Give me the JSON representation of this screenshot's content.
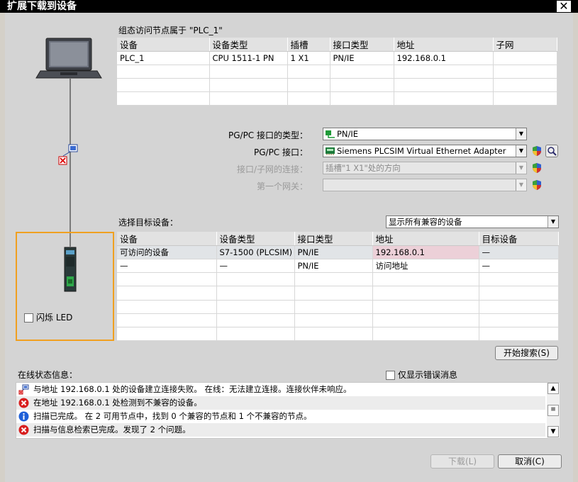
{
  "window": {
    "title": "扩展下载到设备",
    "close_glyph": "✕"
  },
  "config_section": {
    "label": "组态访问节点属于 \"PLC_1\"",
    "columns": [
      "设备",
      "设备类型",
      "插槽",
      "接口类型",
      "地址",
      "子网"
    ],
    "rows": [
      [
        "PLC_1",
        "CPU 1511-1 PN",
        "1 X1",
        "PN/IE",
        "192.168.0.1",
        ""
      ]
    ]
  },
  "pg_pc": {
    "type_label": "PG/PC 接口的类型：",
    "type_value": "PN/IE",
    "interface_label": "PG/PC 接口：",
    "interface_value": "Siemens PLCSIM Virtual Ethernet Adapter",
    "subnet_conn_label": "接口/子网的连接：",
    "subnet_conn_value": "插槽\"1 X1\"处的方向",
    "gateway_label": "第一个网关：",
    "gateway_value": ""
  },
  "target": {
    "label": "选择目标设备：",
    "filter_value": "显示所有兼容的设备",
    "columns": [
      "设备",
      "设备类型",
      "接口类型",
      "地址",
      "目标设备"
    ],
    "rows": [
      [
        "可访问的设备",
        "S7-1500 (PLCSIM)",
        "PN/IE",
        "192.168.0.1",
        "—"
      ],
      [
        "—",
        "—",
        "PN/IE",
        "访问地址",
        "—"
      ]
    ]
  },
  "flash_led_label": "闪烁 LED",
  "start_search_label": "开始搜索(S)",
  "online_status": {
    "label": "在线状态信息：",
    "errors_only_label": "仅显示错误消息",
    "messages": [
      {
        "icon": "network-error-icon",
        "text": "与地址 192.168.0.1 处的设备建立连接失败。 在线：无法建立连接。连接伙伴未响应。"
      },
      {
        "icon": "error-icon",
        "text": "在地址 192.168.0.1 处检测到不兼容的设备。"
      },
      {
        "icon": "info-icon",
        "text": "扫描已完成。 在 2 可用节点中，找到 0 个兼容的节点和 1 个不兼容的节点。"
      },
      {
        "icon": "error-icon",
        "text": "扫描与信息检索已完成。发现了 2 个问题。"
      }
    ]
  },
  "buttons": {
    "download_label": "下载(L)",
    "cancel_label": "取消(C)"
  },
  "colors": {
    "highlight_border": "#f0a020",
    "address_highlight": "#ecd0d8",
    "error_red": "#d81e1e",
    "info_blue": "#1e5fd8"
  }
}
